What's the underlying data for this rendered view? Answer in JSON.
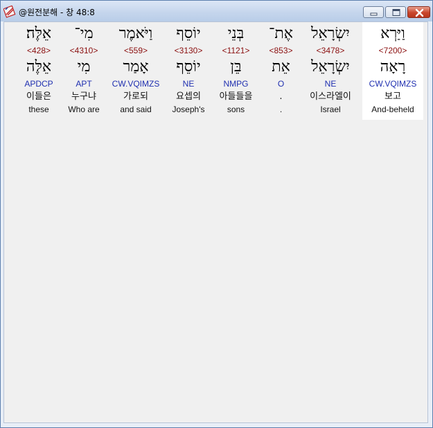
{
  "window": {
    "title": "@원전분해 - 창 48:8"
  },
  "words": [
    {
      "hebrew": "אֵלֶּה׃",
      "strong": "<428>",
      "lemma": "אֵלֶּה",
      "morph": "APDCP",
      "korean": "이들은",
      "english": "these"
    },
    {
      "hebrew": "מִי־",
      "strong": "<4310>",
      "lemma": "מִי",
      "morph": "APT",
      "korean": "누구냐",
      "english": "Who are"
    },
    {
      "hebrew": "וַיֹּאמֶר",
      "strong": "<559>",
      "lemma": "אָמַר",
      "morph": "CW.VQIMZS",
      "korean": "가로되",
      "english": "and said"
    },
    {
      "hebrew": "יוֹסֵף",
      "strong": "<3130>",
      "lemma": "יוֹסֵף",
      "morph": "NE",
      "korean": "요셉의",
      "english": "Joseph's"
    },
    {
      "hebrew": "בְּנֵי",
      "strong": "<1121>",
      "lemma": "בֵּן",
      "morph": "NMPG",
      "korean": "아들들을",
      "english": "sons"
    },
    {
      "hebrew": "אֶת־",
      "strong": "<853>",
      "lemma": "אֵת",
      "morph": "O",
      "korean": ".",
      "english": "."
    },
    {
      "hebrew": "יִשְׂרָאֵל",
      "strong": "<3478>",
      "lemma": "יִשְׂרָאֵל",
      "morph": "NE",
      "korean": "이스라엘이",
      "english": "Israel"
    },
    {
      "hebrew": "וַיַּרְא",
      "strong": "<7200>",
      "lemma": "רָאָה",
      "morph": "CW.VQIMZS",
      "korean": "보고",
      "english": "And-beheld"
    }
  ]
}
